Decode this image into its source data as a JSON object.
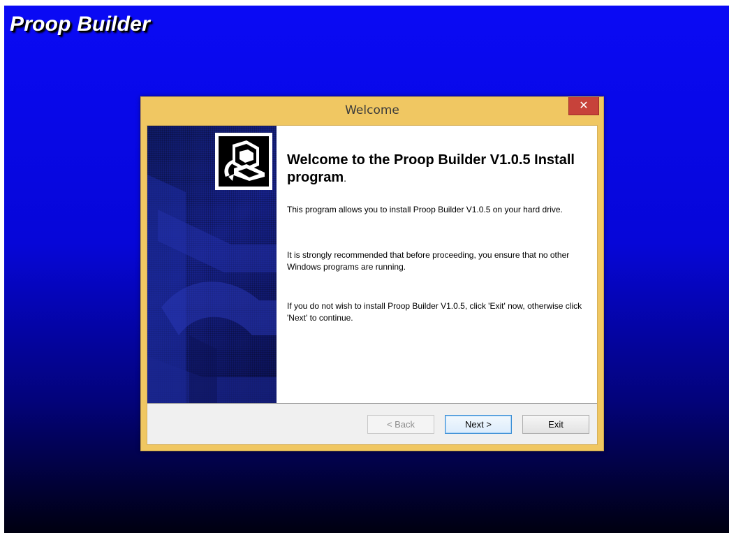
{
  "app": {
    "title": "Proop Builder"
  },
  "dialog": {
    "title": "Welcome",
    "close_symbol": "✕",
    "heading": "Welcome to the Proop Builder V1.0.5 Install program",
    "heading_suffix": ".",
    "paragraphs": [
      "This program allows you to install Proop Builder V1.0.5 on your hard drive.",
      "It is strongly recommended that before proceeding, you ensure that no other Windows programs are running.",
      "If you do not wish to install Proop Builder V1.0.5, click 'Exit' now, otherwise click 'Next' to continue."
    ],
    "buttons": {
      "back": "< Back",
      "next": "Next >",
      "exit": "Exit"
    },
    "icons": {
      "close": "close-icon",
      "setup": "setup-computer-icon"
    }
  },
  "colors": {
    "desktop_top": "#0a0af5",
    "desktop_bottom": "#000010",
    "titlebar": "#f0c762",
    "close_button": "#c7423a",
    "banner": "#17228c",
    "next_button_border": "#3c8fd6"
  }
}
